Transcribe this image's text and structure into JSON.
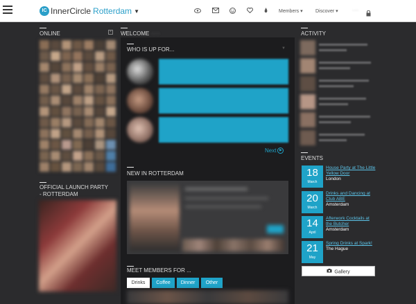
{
  "header": {
    "brand": "InnerCircle",
    "city": "Rotterdam",
    "logo_badge": "IC",
    "menus": [
      "Members",
      "Discover"
    ],
    "icons": [
      "eye-icon",
      "mail-icon",
      "smiley-icon",
      "heart-icon",
      "fire-icon"
    ]
  },
  "online": {
    "title": "Online"
  },
  "launch": {
    "title_line1": "Official Launch Party",
    "title_line2": "- Rotterdam"
  },
  "welcome": {
    "title": "Welcome"
  },
  "who_is_up": {
    "title": "Who is up for...",
    "next_label": "Next"
  },
  "new_in": {
    "title": "New in Rotterdam"
  },
  "meet": {
    "title": "Meet members for ...",
    "filters": [
      "Drinks",
      "Coffee",
      "Dinner",
      "Other"
    ],
    "active_filter": "Drinks"
  },
  "activity": {
    "title": "Activity"
  },
  "events": {
    "title": "Events",
    "items": [
      {
        "day": "18",
        "month": "March",
        "title": "House Party at The Little Yellow Door",
        "city": "London"
      },
      {
        "day": "20",
        "month": "March",
        "title": "Drinks and Dancing at Club ABE",
        "city": "Amsterdam"
      },
      {
        "day": "14",
        "month": "April",
        "title": "Afterwork Cocktails at the Butcher",
        "city": "Amsterdam"
      },
      {
        "day": "21",
        "month": "May",
        "title": "Spring Drinks at Spark!",
        "city": "The Hague"
      }
    ],
    "gallery_label": "Gallery"
  },
  "colors": {
    "accent": "#1fa3c8",
    "background": "#2b2b2d",
    "panel": "#1c1c1e"
  }
}
